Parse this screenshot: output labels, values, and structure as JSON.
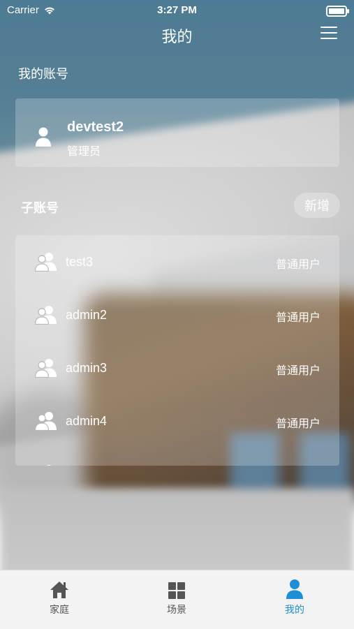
{
  "status_bar": {
    "carrier": "Carrier",
    "time": "3:27 PM"
  },
  "navbar": {
    "title": "我的",
    "menu_icon": "menu-icon"
  },
  "account": {
    "section_title": "我的账号",
    "username": "devtest2",
    "role": "管理员"
  },
  "subaccounts": {
    "header": "子账号",
    "add_label": "新增",
    "items": [
      {
        "name": "test3",
        "role": "普通用户"
      },
      {
        "name": "admin2",
        "role": "普通用户"
      },
      {
        "name": "admin3",
        "role": "普通用户"
      },
      {
        "name": "admin4",
        "role": "普通用户"
      }
    ]
  },
  "tabbar": {
    "items": [
      {
        "label": "家庭",
        "icon": "home-icon"
      },
      {
        "label": "场景",
        "icon": "grid-icon"
      },
      {
        "label": "我的",
        "icon": "person-icon"
      }
    ],
    "active_color": "#1e8fd6"
  }
}
